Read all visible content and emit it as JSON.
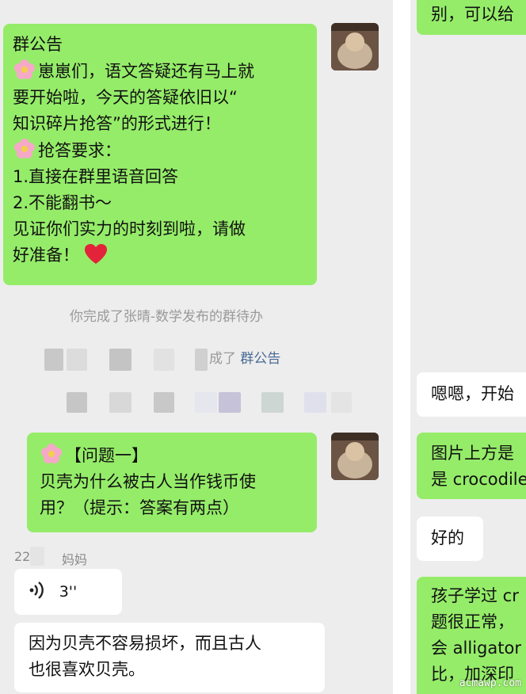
{
  "left": {
    "announcement": {
      "title": "群公告",
      "lines": [
        "崽崽们，语文答疑还有马上就",
        "要开始啦，今天的答疑依旧以“",
        "知识碎片抢答”的形式进行！"
      ],
      "rules_title": "抢答要求：",
      "rule1": "1.直接在群里语音回答",
      "rule2": "2.不能翻书～",
      "closing1": "见证你们实力的时刻到啦，请做",
      "closing2": "好准备！"
    },
    "system_msg": "你完成了张晴-数学发布的群待办",
    "system_msg2_prefix": "成了",
    "system_msg2_link": "群公告",
    "question": {
      "title": "【问题一】",
      "line1": "贝壳为什么被古人当作钱币使",
      "line2": "用？（提示：答案有两点）"
    },
    "sender_num": "22",
    "sender_name": "妈妈",
    "voice_duration": "3''",
    "answer_line1": "因为贝壳不容易损坏，而且古人",
    "answer_line2": "也很喜欢贝壳。"
  },
  "right": {
    "top_text": "别，可以给",
    "msg1": "嗯嗯，开始",
    "msg2_line1": "图片上方是",
    "msg2_line2": "是 crocodile",
    "msg3": "好的",
    "msg4_line1": "孩子学过 cr",
    "msg4_line2": "题很正常，",
    "msg4_line3": "会 alligator",
    "msg4_line4": "比，加深印"
  },
  "watermark": "acmawp.com",
  "colors": {
    "chat_bg": "#ededed",
    "self_bubble": "#95ec69",
    "other_bubble": "#ffffff",
    "system_text": "#9a9a9a",
    "link_text": "#4a6a94"
  },
  "icons": [
    "flower-emoji-icon",
    "red-heart-icon",
    "voice-wave-icon",
    "avatar-photo"
  ]
}
